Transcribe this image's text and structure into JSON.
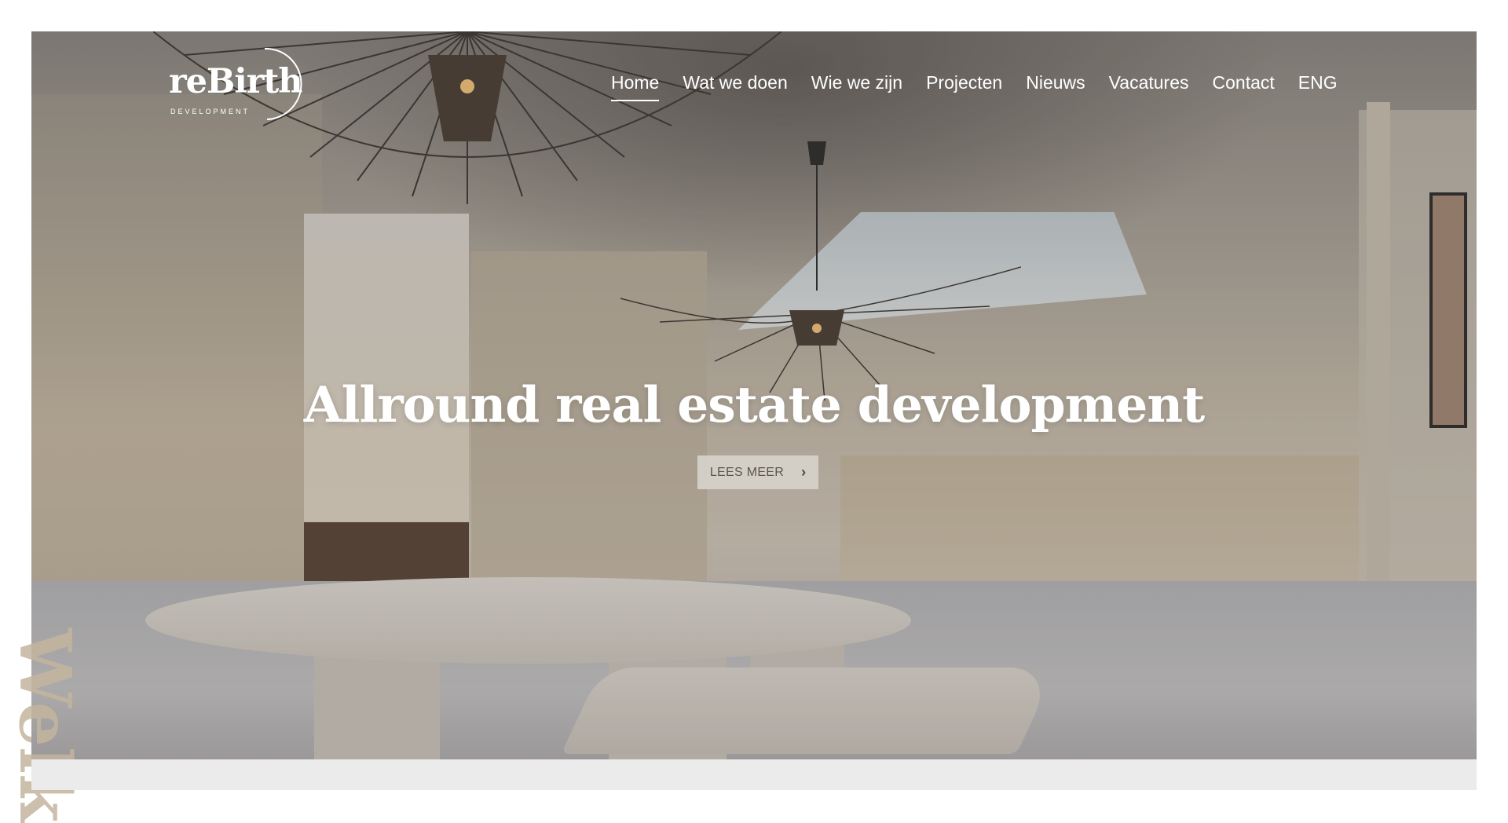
{
  "logo": {
    "wordmark": "reBirth",
    "subtitle": "DEVELOPMENT"
  },
  "nav": {
    "items": [
      {
        "label": "Home",
        "active": true
      },
      {
        "label": "Wat we doen"
      },
      {
        "label": "Wie we zijn"
      },
      {
        "label": "Projecten"
      },
      {
        "label": "Nieuws"
      },
      {
        "label": "Vacatures"
      },
      {
        "label": "Contact"
      },
      {
        "label": "ENG"
      }
    ]
  },
  "hero": {
    "headline": "Allround real estate development",
    "cta_label": "LEES MEER",
    "cta_icon": "chevron-right-icon",
    "side_text": "Welk"
  },
  "colors": {
    "band": "#ebebeb",
    "cta_bg": "#d7d2ca",
    "side_text": "#c4b59e"
  }
}
